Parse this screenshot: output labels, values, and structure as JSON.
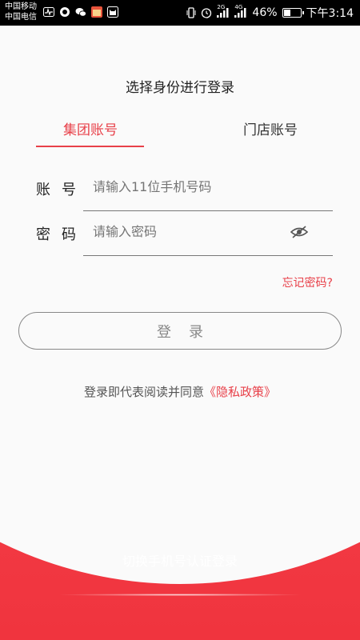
{
  "status_bar": {
    "carrier_1": "中国移动",
    "carrier_2": "中国电信",
    "network_2g": "2G",
    "network_4g": "4G",
    "battery_text": "46%",
    "battery_level": 0.46,
    "time": "下午3:14"
  },
  "login": {
    "title": "选择身份进行登录",
    "tabs": [
      {
        "label": "集团账号",
        "active": true
      },
      {
        "label": "门店账号",
        "active": false
      }
    ],
    "account_label": "账号",
    "account_placeholder": "请输入11位手机号码",
    "password_label": "密码",
    "password_placeholder": "请输入密码",
    "forgot_password": "忘记密码?",
    "login_button": "登录",
    "agreement_text": "登录即代表阅读并同意",
    "privacy_link": "《隐私政策》"
  },
  "footer": {
    "switch_label": "切换手机号认证登录"
  },
  "colors": {
    "accent": "#e84049",
    "red_background": "#f23a43",
    "page_background": "#fafafa"
  }
}
